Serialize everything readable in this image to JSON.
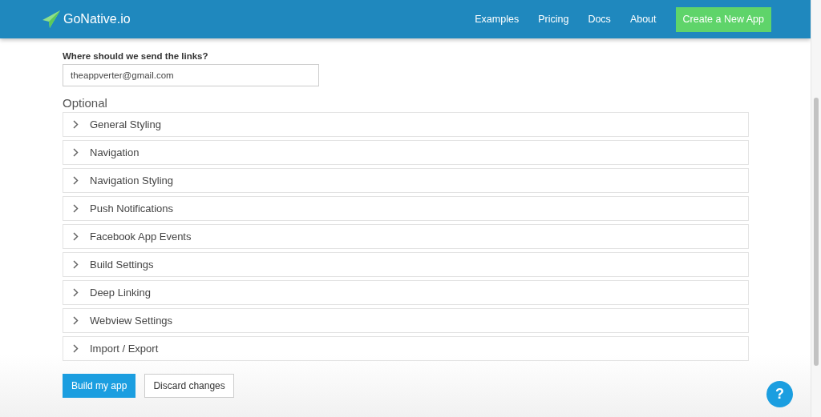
{
  "header": {
    "logo_text": "GoNative.io",
    "nav": [
      "Examples",
      "Pricing",
      "Docs",
      "About"
    ],
    "cta": "Create a New App"
  },
  "form": {
    "email": {
      "label": "Where should we send the links?",
      "value": "theappverter@gmail.com"
    },
    "optional_heading": "Optional",
    "sections": [
      {
        "label": "General Styling",
        "expanded": false
      },
      {
        "label": "Navigation",
        "expanded": false
      },
      {
        "label": "Navigation Styling",
        "expanded": false
      },
      {
        "label": "Push Notifications",
        "expanded": false
      },
      {
        "label": "Facebook App Events",
        "expanded": false
      },
      {
        "label": "Build Settings",
        "expanded": false
      },
      {
        "label": "Deep Linking",
        "expanded": false
      },
      {
        "label": "Webview Settings",
        "expanded": false
      },
      {
        "label": "Import / Export",
        "expanded": false
      }
    ],
    "buttons": {
      "primary": "Build my app",
      "secondary": "Discard changes"
    }
  },
  "help_button": "?"
}
